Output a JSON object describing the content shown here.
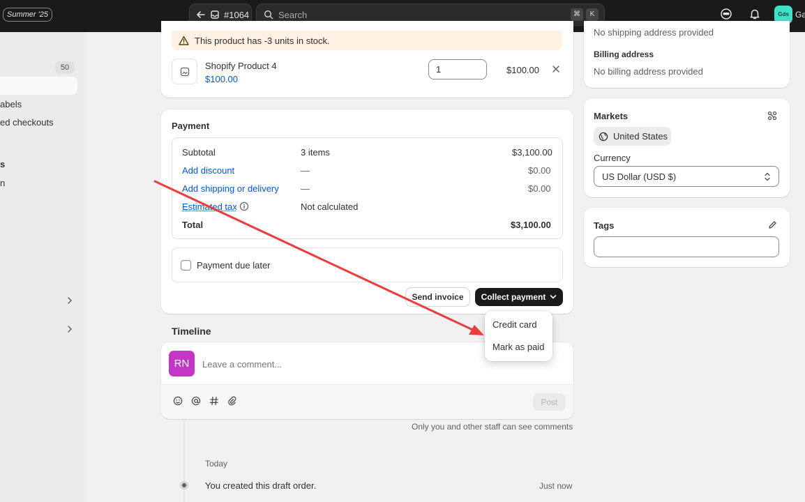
{
  "topbar": {
    "summer_badge": "Summer '25",
    "order_number": "#1064",
    "search_placeholder": "Search",
    "shortcut_cmd": "⌘",
    "shortcut_key": "K",
    "store_avatar": "Gds",
    "store_name_partial": "Ga"
  },
  "sidebar": {
    "count": "50",
    "items": [
      {
        "label": "abels"
      },
      {
        "label": "ed checkouts"
      },
      {
        "label": "s"
      },
      {
        "label": "n"
      }
    ]
  },
  "product": {
    "stock_warning": "This product has -3 units in stock.",
    "name": "Shopify Product 4",
    "unit_price": "$100.00",
    "quantity": "1",
    "line_total": "$100.00"
  },
  "payment": {
    "title": "Payment",
    "rows": [
      {
        "label": "Subtotal",
        "detail": "3 items",
        "amount": "$3,100.00"
      },
      {
        "label": "Add discount",
        "detail": "—",
        "amount": "$0.00"
      },
      {
        "label": "Add shipping or delivery",
        "detail": "—",
        "amount": "$0.00"
      },
      {
        "label": "Estimated tax",
        "detail": "Not calculated",
        "amount": ""
      },
      {
        "label": "Total",
        "detail": "",
        "amount": "$3,100.00"
      }
    ],
    "due_later_label": "Payment due later",
    "send_invoice": "Send invoice",
    "collect_payment": "Collect payment",
    "dropdown": [
      "Credit card",
      "Mark as paid"
    ]
  },
  "timeline": {
    "title": "Timeline",
    "avatar_initials": "RN",
    "comment_placeholder": "Leave a comment...",
    "post_label": "Post",
    "staff_note": "Only you and other staff can see comments",
    "day_label": "Today",
    "event_text": "You created this draft order.",
    "event_time": "Just now"
  },
  "right": {
    "shipping_partial": "No shipping address provided",
    "billing_title": "Billing address",
    "billing_text": "No billing address provided",
    "markets_title": "Markets",
    "market_value": "United States",
    "currency_label": "Currency",
    "currency_value": "US Dollar (USD $)",
    "tags_title": "Tags"
  },
  "colors": {
    "link": "#005bd3",
    "annotation_arrow": "#ee3b3b",
    "primary_button": "#1a1a1a",
    "avatar": "#c437c6",
    "store_avatar": "#3de2c8"
  }
}
